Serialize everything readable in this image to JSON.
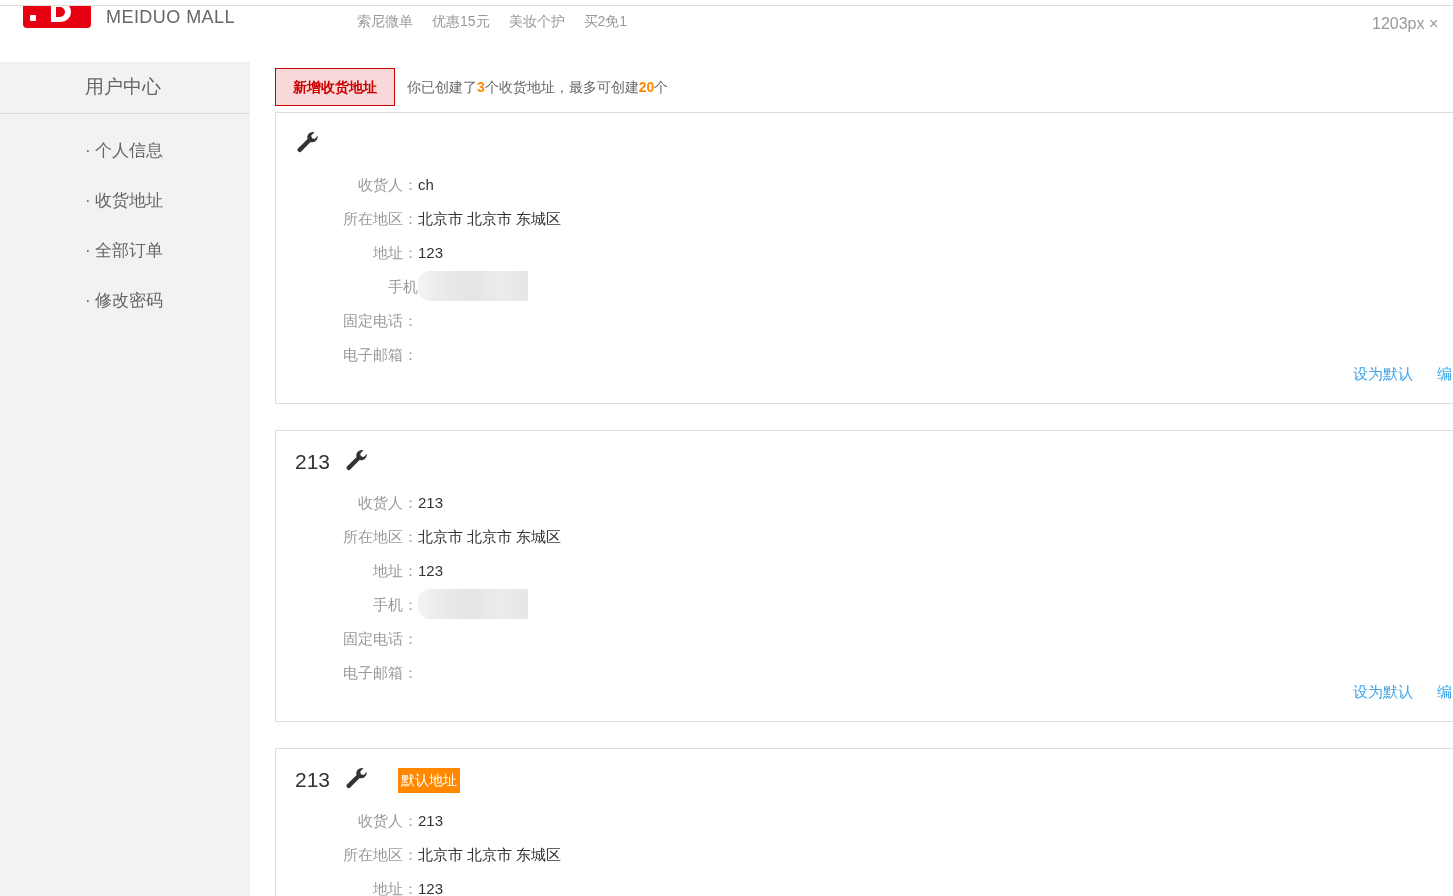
{
  "header": {
    "brand": "MEIDUO MALL",
    "nav": [
      "索尼微单",
      "优惠15元",
      "美妆个护",
      "买2免1"
    ],
    "size_hint": "1203px ×"
  },
  "sidebar": {
    "title": "用户中心",
    "items": [
      {
        "label": "· 个人信息",
        "selected": false
      },
      {
        "label": "· 收货地址",
        "selected": false
      },
      {
        "label": "· 全部订单",
        "selected": false
      },
      {
        "label": "· 修改密码",
        "selected": false
      }
    ]
  },
  "toolbar": {
    "add_button": "新增收货地址",
    "note": "你已创建了**3**个收货地址，最多可创建**20**个"
  },
  "addresses": [
    {
      "fields": [
        {
          "label": "收货人：",
          "value": "ch"
        },
        {
          "label": "所在地区：",
          "value": "北京市 北京市 东城区"
        },
        {
          "label": "地址：",
          "value": "123"
        },
        {
          "label": "手机",
          "redacted": true
        },
        {
          "label": "固定电话："
        },
        {
          "label": "电子邮箱："
        }
      ],
      "actions": [
        "设为默认",
        "编"
      ]
    },
    {
      "title": "213",
      "fields": [
        {
          "label": "收货人：",
          "value": "213"
        },
        {
          "label": "所在地区：",
          "value": "北京市 北京市 东城区"
        },
        {
          "label": "地址：",
          "value": "123"
        },
        {
          "label": "手机：",
          "redacted": true
        },
        {
          "label": "固定电话："
        },
        {
          "label": "电子邮箱："
        }
      ],
      "actions": [
        "设为默认",
        "编"
      ]
    },
    {
      "title": "213",
      "default_badge": "默认地址",
      "fields": [
        {
          "label": "收货人：",
          "value": "213"
        },
        {
          "label": "所在地区：",
          "value": "北京市 北京市 东城区"
        },
        {
          "label": "地址：",
          "value": "123"
        }
      ]
    }
  ]
}
